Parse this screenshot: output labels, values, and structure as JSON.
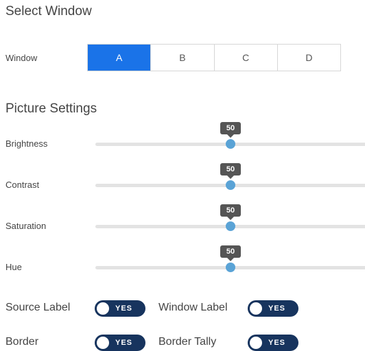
{
  "select_window": {
    "title": "Select Window",
    "window_label": "Window",
    "options": [
      "A",
      "B",
      "C",
      "D"
    ],
    "selected": "A"
  },
  "picture_settings": {
    "title": "Picture Settings",
    "sliders": [
      {
        "label": "Brightness",
        "value": "50"
      },
      {
        "label": "Contrast",
        "value": "50"
      },
      {
        "label": "Saturation",
        "value": "50"
      },
      {
        "label": "Hue",
        "value": "50"
      }
    ]
  },
  "toggles": [
    {
      "label": "Source Label",
      "state": "YES"
    },
    {
      "label": "Window Label",
      "state": "YES"
    },
    {
      "label": "Border",
      "state": "YES"
    },
    {
      "label": "Border Tally",
      "state": "YES"
    }
  ],
  "colors": {
    "accent": "#1a73e8",
    "toggle_on": "#17345e",
    "slider_thumb": "#5aa3d6"
  }
}
